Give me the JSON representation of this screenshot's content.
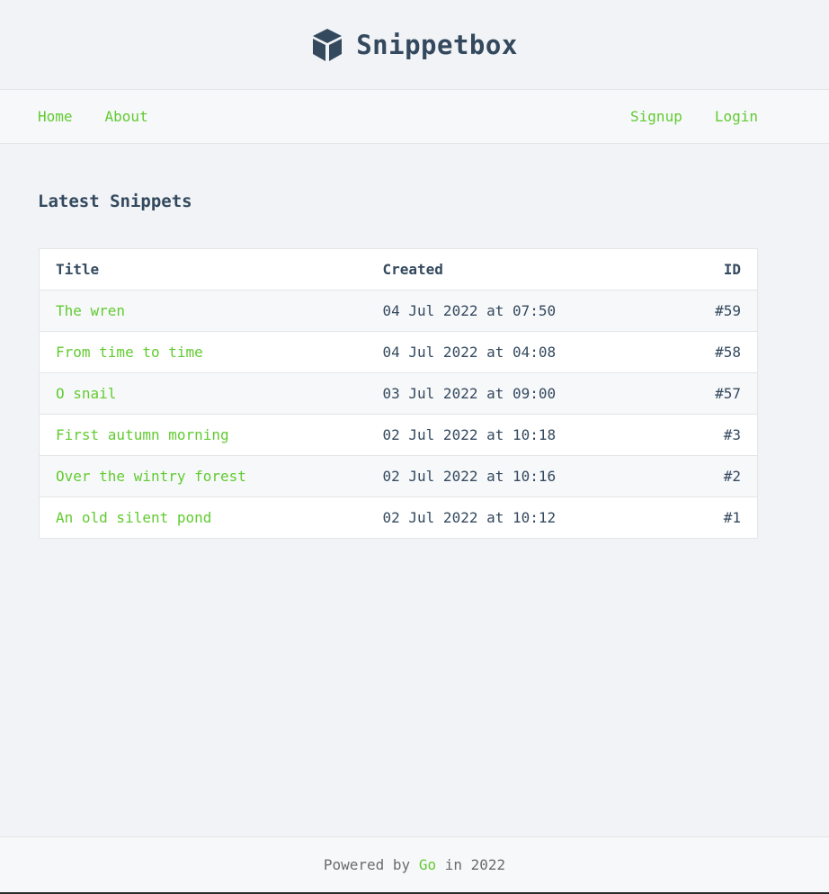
{
  "header": {
    "brand": "Snippetbox",
    "logo_icon": "cube-icon",
    "colors": {
      "text": "#34495e",
      "accent": "#62cb31"
    }
  },
  "nav": {
    "left": [
      {
        "label": "Home"
      },
      {
        "label": "About"
      }
    ],
    "right": [
      {
        "label": "Signup"
      },
      {
        "label": "Login"
      }
    ]
  },
  "main": {
    "heading": "Latest Snippets",
    "table": {
      "headers": {
        "title": "Title",
        "created": "Created",
        "id": "ID"
      },
      "rows": [
        {
          "title": "The wren",
          "created": "04 Jul 2022 at 07:50",
          "id": "#59"
        },
        {
          "title": "From time to time",
          "created": "04 Jul 2022 at 04:08",
          "id": "#58"
        },
        {
          "title": "O snail",
          "created": "03 Jul 2022 at 09:00",
          "id": "#57"
        },
        {
          "title": "First autumn morning",
          "created": "02 Jul 2022 at 10:18",
          "id": "#3"
        },
        {
          "title": "Over the wintry forest",
          "created": "02 Jul 2022 at 10:16",
          "id": "#2"
        },
        {
          "title": "An old silent pond",
          "created": "02 Jul 2022 at 10:12",
          "id": "#1"
        }
      ]
    }
  },
  "footer": {
    "prefix": "Powered by",
    "link": "Go",
    "suffix": "in 2022"
  }
}
